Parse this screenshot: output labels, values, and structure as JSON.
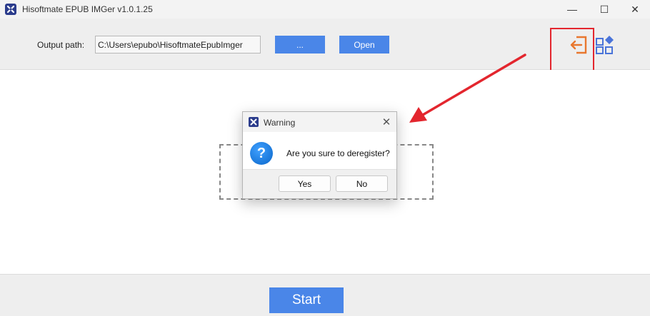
{
  "window": {
    "title": "Hisoftmate EPUB IMGer v1.0.1.25",
    "minimize_glyph": "—",
    "maximize_glyph": "☐",
    "close_glyph": "✕"
  },
  "toolbar": {
    "output_label": "Output path:",
    "output_value": "C:\\Users\\epubo\\HisoftmateEpubImger",
    "browse_label": "...",
    "open_label": "Open",
    "icons": [
      "logout-icon",
      "apps-icon"
    ]
  },
  "bottom": {
    "start_label": "Start"
  },
  "dialog": {
    "title": "Warning",
    "close_glyph": "✕",
    "icon_glyph": "?",
    "message": "Are you sure to deregister?",
    "yes_label": "Yes",
    "no_label": "No"
  },
  "colors": {
    "accent": "#4a86e8",
    "highlight": "#e3262e",
    "logout_icon": "#e8772e",
    "apps_icon": "#4a74d9"
  }
}
